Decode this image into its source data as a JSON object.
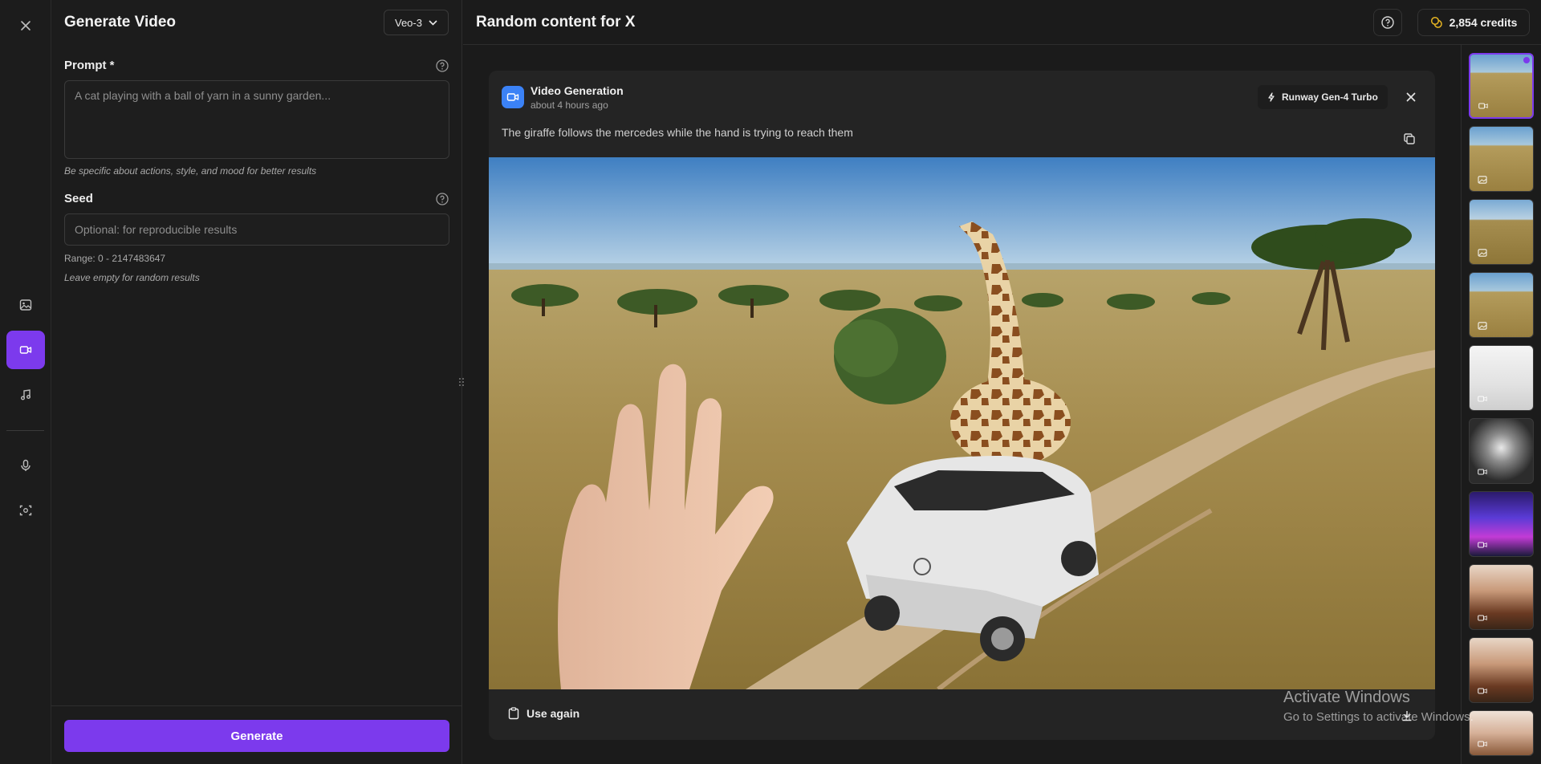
{
  "rail": {
    "items": [
      {
        "name": "close"
      },
      {
        "name": "image"
      },
      {
        "name": "video",
        "active": true
      },
      {
        "name": "music"
      },
      {
        "name": "microphone"
      },
      {
        "name": "scan"
      }
    ]
  },
  "panel": {
    "title": "Generate Video",
    "model": "Veo-3",
    "prompt_label": "Prompt *",
    "prompt_placeholder": "A cat playing with a ball of yarn in a sunny garden...",
    "prompt_hint": "Be specific about actions, style, and mood for better results",
    "seed_label": "Seed",
    "seed_placeholder": "Optional: for reproducible results",
    "seed_range": "Range: 0 - 2147483647",
    "seed_hint": "Leave empty for random results",
    "generate_label": "Generate"
  },
  "header": {
    "title": "Random content for X",
    "credits": "2,854 credits"
  },
  "card": {
    "title": "Video Generation",
    "time": "about 4 hours ago",
    "model_badge": "Runway Gen-4 Turbo",
    "prompt": "The giraffe follows the mercedes while the hand is trying to reach them",
    "use_again_label": "Use again"
  },
  "thumbnails": [
    {
      "type": "video",
      "scene": "safari",
      "selected": true
    },
    {
      "type": "image",
      "scene": "safari"
    },
    {
      "type": "image",
      "scene": "safari-close"
    },
    {
      "type": "image",
      "scene": "safari"
    },
    {
      "type": "video",
      "scene": "white-room"
    },
    {
      "type": "video",
      "scene": "crowd"
    },
    {
      "type": "video",
      "scene": "neon-city"
    },
    {
      "type": "video",
      "scene": "woman-food"
    },
    {
      "type": "video",
      "scene": "woman-food"
    },
    {
      "type": "video",
      "scene": "woman"
    }
  ],
  "watermark": {
    "line1": "Activate Windows",
    "line2": "Go to Settings to activate Windows."
  },
  "colors": {
    "accent": "#7c3aed",
    "card_icon": "#3b82f6",
    "credits_icon": "#e6b422"
  }
}
